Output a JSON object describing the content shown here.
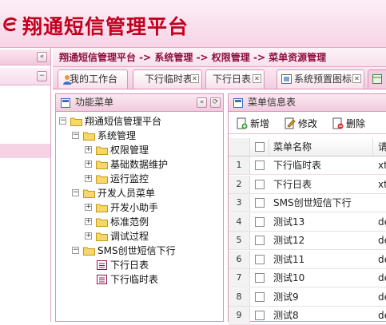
{
  "app": {
    "title": "翔通短信管理平台"
  },
  "left_panel": {
    "collapse_symbol": "«",
    "minus_symbol": "−"
  },
  "breadcrumb": {
    "text": "翔通短信管理平台 -> 系统管理 -> 权限管理 -> 菜单资源管理"
  },
  "tabs": [
    {
      "label": "我的工作台",
      "closable": false
    },
    {
      "label": "下行临时表",
      "closable": true
    },
    {
      "label": "下行日表",
      "closable": true
    },
    {
      "label": "系统预置图标",
      "closable": true
    }
  ],
  "close_symbol": "✕",
  "menu_panel": {
    "title": "功能菜单",
    "collapse_symbol": "«",
    "refresh_symbol": "⟳",
    "tree": [
      {
        "label": "翔通短信管理平台",
        "level": 0,
        "type": "folder",
        "toggle": "−"
      },
      {
        "label": "系统管理",
        "level": 1,
        "type": "folder",
        "toggle": "−"
      },
      {
        "label": "权限管理",
        "level": 2,
        "type": "folder",
        "toggle": "+"
      },
      {
        "label": "基础数据维护",
        "level": 2,
        "type": "folder",
        "toggle": "+"
      },
      {
        "label": "运行监控",
        "level": 2,
        "type": "folder",
        "toggle": "+"
      },
      {
        "label": "开发人员菜单",
        "level": 1,
        "type": "folder",
        "toggle": "−"
      },
      {
        "label": "开发小助手",
        "level": 2,
        "type": "folder",
        "toggle": "+"
      },
      {
        "label": "标准范例",
        "level": 2,
        "type": "folder",
        "toggle": "+"
      },
      {
        "label": "调试过程",
        "level": 2,
        "type": "folder",
        "toggle": "+"
      },
      {
        "label": "SMS创世短信下行",
        "level": 1,
        "type": "folder",
        "toggle": "−"
      },
      {
        "label": "下行日表",
        "level": 2,
        "type": "leaf",
        "toggle": ""
      },
      {
        "label": "下行临时表",
        "level": 2,
        "type": "leaf",
        "toggle": ""
      }
    ]
  },
  "info_panel": {
    "title": "菜单信息表",
    "toolbar": {
      "add": "新增",
      "edit": "修改",
      "delete": "删除"
    },
    "columns": {
      "name": "菜单名称",
      "code": "请"
    },
    "rows": [
      {
        "n": "1",
        "name": "下行临时表",
        "code": "xto"
      },
      {
        "n": "2",
        "name": "下行日表",
        "code": "xto"
      },
      {
        "n": "3",
        "name": "SMS创世短信下行",
        "code": ""
      },
      {
        "n": "4",
        "name": "测试13",
        "code": "de"
      },
      {
        "n": "5",
        "name": "测试12",
        "code": "de"
      },
      {
        "n": "6",
        "name": "测试11",
        "code": "de"
      },
      {
        "n": "7",
        "name": "测试10",
        "code": "de"
      },
      {
        "n": "8",
        "name": "测试9",
        "code": "de"
      },
      {
        "n": "9",
        "name": "测试8",
        "code": "de"
      }
    ]
  },
  "colors": {
    "brand": "#c2001e",
    "accent_pink": "#f3cfe0",
    "border": "#d894b6",
    "breadcrumb": "#8e0f3e"
  }
}
